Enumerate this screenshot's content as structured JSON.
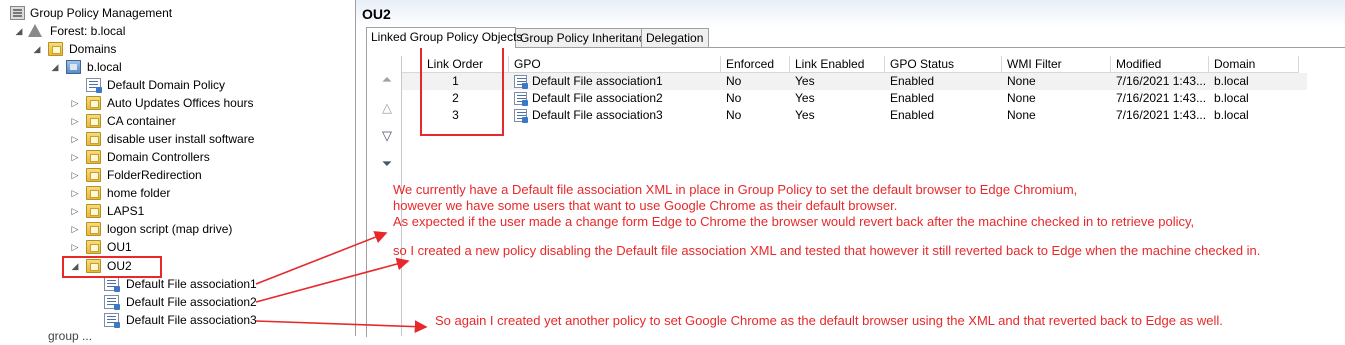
{
  "tree": {
    "root": "Group Policy Management",
    "forest": "Forest: b.local",
    "domains": "Domains",
    "domain": "b.local",
    "items": [
      "Default Domain Policy",
      "Auto Updates Offices hours",
      "CA container",
      "disable user install software",
      "Domain Controllers",
      "FolderRedirection",
      "home folder",
      "LAPS1",
      "logon script (map drive)",
      "OU1",
      "OU2"
    ],
    "ou2_children": [
      "Default File association1",
      "Default File association2",
      "Default File association3"
    ],
    "partial_bottom": "group ..."
  },
  "pane": {
    "title": "OU2",
    "tabs": [
      "Linked Group Policy Objects",
      "Group Policy Inheritance",
      "Delegation"
    ],
    "columns": [
      "Link Order",
      "GPO",
      "Enforced",
      "Link Enabled",
      "GPO Status",
      "WMI Filter",
      "Modified",
      "Domain"
    ],
    "rows": [
      {
        "order": "1",
        "gpo": "Default File association1",
        "enforced": "No",
        "link_enabled": "Yes",
        "status": "Enabled",
        "wmi": "None",
        "modified": "7/16/2021 1:43...",
        "domain": "b.local"
      },
      {
        "order": "2",
        "gpo": "Default File association2",
        "enforced": "No",
        "link_enabled": "Yes",
        "status": "Enabled",
        "wmi": "None",
        "modified": "7/16/2021 1:43...",
        "domain": "b.local"
      },
      {
        "order": "3",
        "gpo": "Default File association3",
        "enforced": "No",
        "link_enabled": "Yes",
        "status": "Enabled",
        "wmi": "None",
        "modified": "7/16/2021 1:43...",
        "domain": "b.local"
      }
    ]
  },
  "notes": {
    "line1": "We currently have a Default file association XML in place in Group Policy to set the default browser to Edge Chromium,",
    "line2": "however we have some users that want to use Google Chrome as their default browser.",
    "line3": "As expected if the user made a change form Edge to Chrome the browser would revert back after the machine checked in to retrieve policy,",
    "line4": "so I created a new policy disabling the Default file association XML and tested that however it still reverted back to Edge when the machine checked in.",
    "line5": "So again I created yet another policy to set Google Chrome as the default browser using the XML and that reverted back to Edge as well."
  },
  "colors": {
    "annotation_red": "#e8282a",
    "folder_yellow": "#e6b93a"
  }
}
